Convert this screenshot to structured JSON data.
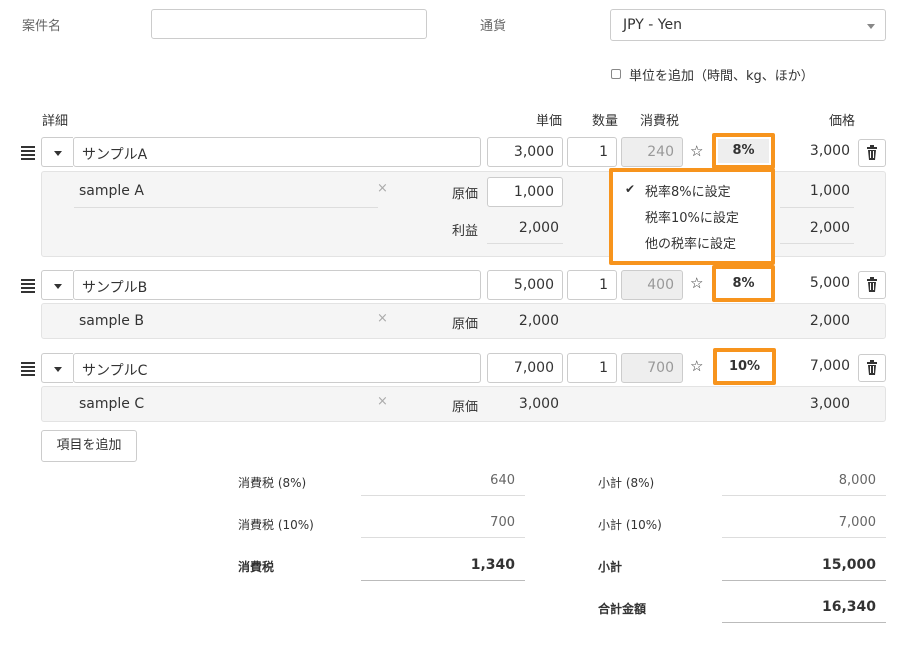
{
  "header": {
    "project_label": "案件名",
    "project_value": "",
    "currency_label": "通貨",
    "currency_value": "JPY - Yen",
    "unit_checkbox_label": "単位を追加（時間、kg、ほか）"
  },
  "columns": {
    "detail": "詳細",
    "unit_price": "単価",
    "quantity": "数量",
    "tax": "消費税",
    "price": "価格"
  },
  "items": [
    {
      "name": "サンプルA",
      "unit_price": "3,000",
      "quantity": "1",
      "tax_amount": "240",
      "tax_rate": "8%",
      "price": "3,000",
      "sub_desc": "sample A",
      "cost_label": "原価",
      "cost": "1,000",
      "cost_price": "1,000",
      "profit_label": "利益",
      "profit": "2,000",
      "profit_price": "2,000"
    },
    {
      "name": "サンプルB",
      "unit_price": "5,000",
      "quantity": "1",
      "tax_amount": "400",
      "tax_rate": "8%",
      "price": "5,000",
      "sub_desc": "sample B",
      "cost_label": "原価",
      "cost": "2,000",
      "cost_price": "2,000"
    },
    {
      "name": "サンプルC",
      "unit_price": "7,000",
      "quantity": "1",
      "tax_amount": "700",
      "tax_rate": "10%",
      "price": "7,000",
      "sub_desc": "sample C",
      "cost_label": "原価",
      "cost": "3,000",
      "cost_price": "3,000"
    }
  ],
  "tax_menu": {
    "check": "✔",
    "options": [
      "税率8%に設定",
      "税率10%に設定",
      "他の税率に設定"
    ]
  },
  "icons": {
    "star": "☆",
    "clear": "×"
  },
  "add_item_label": "項目を追加",
  "summary": {
    "tax8_label": "消費税 (8%)",
    "tax8_value": "640",
    "tax10_label": "消費税 (10%)",
    "tax10_value": "700",
    "tax_total_label": "消費税",
    "tax_total_value": "1,340",
    "sub8_label": "小計 (8%)",
    "sub8_value": "8,000",
    "sub10_label": "小計 (10%)",
    "sub10_value": "7,000",
    "subtotal_label": "小計",
    "subtotal_value": "15,000",
    "grand_label": "合計金額",
    "grand_value": "16,340"
  },
  "colors": {
    "highlight": "#f7941d"
  }
}
